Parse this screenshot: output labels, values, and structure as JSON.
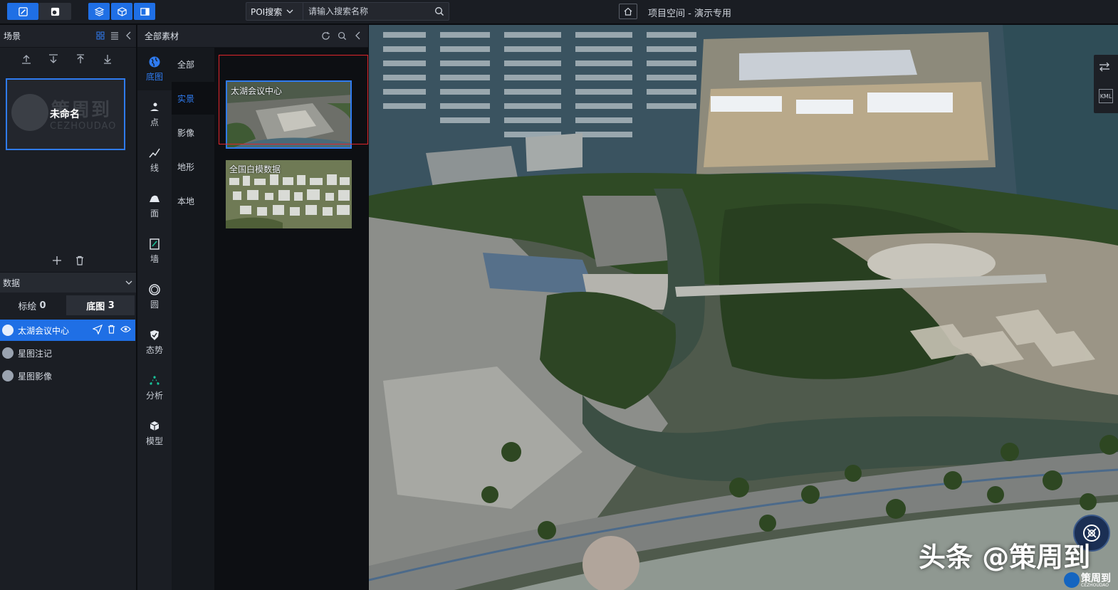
{
  "topbar": {
    "poi_select_label": "POI搜索",
    "search_placeholder": "请输入搜索名称",
    "project_title": "项目空间 - 演示专用"
  },
  "scene_panel": {
    "title": "场景",
    "scene_card": {
      "name": "未命名",
      "logo_text": "策周到",
      "logo_sub": "CEZHOUDAO"
    }
  },
  "data_panel": {
    "title": "数据",
    "tabs": [
      {
        "label": "标绘",
        "count": "0"
      },
      {
        "label": "底图",
        "count": "3"
      }
    ],
    "layers": [
      {
        "label": "太湖会议中心",
        "active": true
      },
      {
        "label": "星图注记",
        "active": false
      },
      {
        "label": "星图影像",
        "active": false
      }
    ]
  },
  "material_panel": {
    "title": "全部素材",
    "categories": [
      {
        "label": "底图",
        "icon": "globe-icon",
        "active": true
      },
      {
        "label": "点",
        "icon": "point-icon",
        "active": false
      },
      {
        "label": "线",
        "icon": "line-icon",
        "active": false
      },
      {
        "label": "面",
        "icon": "area-icon",
        "active": false
      },
      {
        "label": "墙",
        "icon": "wall-icon",
        "active": false
      },
      {
        "label": "圆",
        "icon": "circle-icon",
        "active": false
      },
      {
        "label": "态势",
        "icon": "situation-icon",
        "active": false
      },
      {
        "label": "分析",
        "icon": "analysis-icon",
        "active": false
      },
      {
        "label": "模型",
        "icon": "model-icon",
        "active": false
      }
    ],
    "subcategories": [
      {
        "label": "全部",
        "active": false
      },
      {
        "label": "实景",
        "active": true
      },
      {
        "label": "影像",
        "active": false
      },
      {
        "label": "地形",
        "active": false
      },
      {
        "label": "本地",
        "active": false
      }
    ],
    "thumbnails": [
      {
        "label": "太湖会议中心",
        "selected": true
      },
      {
        "label": "全国白模数据",
        "selected": false
      }
    ]
  },
  "map": {
    "right_tools": [
      "layers-toggle-icon",
      "KML"
    ],
    "watermark": "头条 @策周到",
    "watermark_logo_name": "策周到",
    "watermark_logo_sub": "CEZHOUDAO"
  },
  "colors": {
    "accent": "#1f6fe5",
    "panel_bg": "#1b1e24",
    "highlight_red": "#e0252b"
  }
}
